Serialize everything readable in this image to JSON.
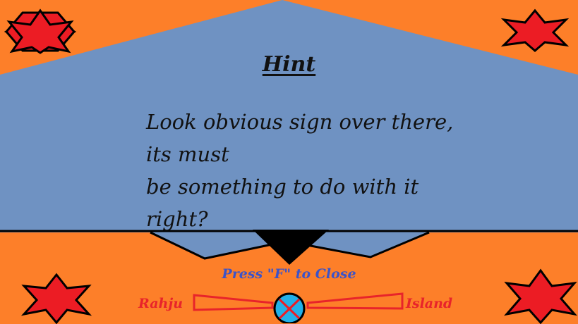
{
  "dialog": {
    "title": "Hint",
    "body_lines": [
      "Look obvious sign over there, its must",
      "be something to do with it right?"
    ],
    "close_prompt": "Press \"F\" to Close"
  },
  "brand": {
    "left_word": "Rahju",
    "right_word": "Island"
  },
  "icons": {
    "corner_decoration": "red-star-icon",
    "close_button": "x-close-icon"
  },
  "colors": {
    "background_orange": "#fd7f29",
    "panel_blue": "#6f92c2",
    "star_red": "#ec1c24",
    "text_black": "#111111",
    "prompt_blue": "#3b53c9",
    "brand_red": "#e8242a",
    "close_circle_fill": "#22b0e8"
  }
}
